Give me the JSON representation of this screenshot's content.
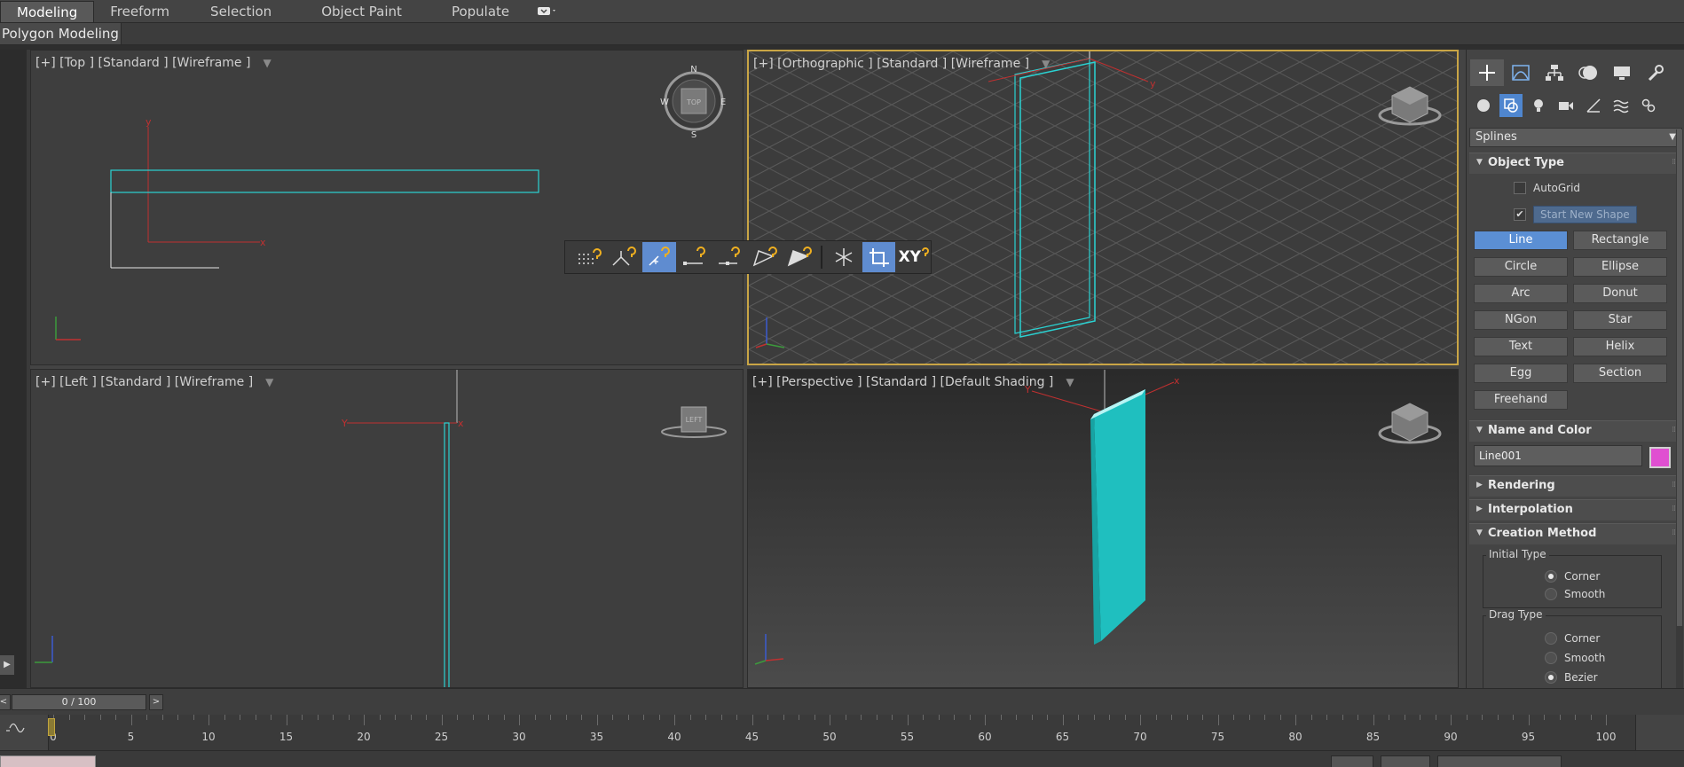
{
  "ribbon": {
    "tabs": [
      "Modeling",
      "Freeform",
      "Selection",
      "Object Paint",
      "Populate"
    ],
    "active_tab": "Modeling",
    "sub_label": "Polygon Modeling"
  },
  "viewports": {
    "top": {
      "label": "[+] [Top ] [Standard ] [Wireframe ]",
      "compass": {
        "n": "N",
        "s": "S",
        "e": "E",
        "w": "W",
        "face": "TOP"
      }
    },
    "ortho": {
      "label": "[+] [Orthographic ] [Standard ] [Wireframe ]"
    },
    "left": {
      "label": "[+] [Left ] [Standard ] [Wireframe ]",
      "cube_face": "LEFT"
    },
    "persp": {
      "label": "[+] [Perspective ] [Standard ] [Default Shading ]"
    }
  },
  "snap_toolbar": {
    "xy_label": "XY"
  },
  "command_panel": {
    "category": "Splines",
    "object_type": {
      "title": "Object Type",
      "autogrid": "AutoGrid",
      "autogrid_checked": false,
      "start_new_shape": "Start New Shape",
      "start_new_shape_checked": true,
      "buttons": [
        "Line",
        "Rectangle",
        "Circle",
        "Ellipse",
        "Arc",
        "Donut",
        "NGon",
        "Star",
        "Text",
        "Helix",
        "Egg",
        "Section",
        "Freehand"
      ],
      "active": "Line"
    },
    "name_and_color": {
      "title": "Name and Color",
      "name": "Line001",
      "color": "#e04fd1"
    },
    "rollouts": [
      "Rendering",
      "Interpolation"
    ],
    "creation_method": {
      "title": "Creation Method",
      "initial_type": {
        "title": "Initial Type",
        "options": [
          "Corner",
          "Smooth"
        ],
        "selected": "Corner"
      },
      "drag_type": {
        "title": "Drag Type",
        "options": [
          "Corner",
          "Smooth",
          "Bezier"
        ],
        "selected": "Bezier"
      }
    }
  },
  "time_slider": {
    "label": "0 / 100",
    "prev": "<",
    "next": ">",
    "ticks": [
      "0",
      "5",
      "10",
      "15",
      "20",
      "25",
      "30",
      "35",
      "40",
      "45",
      "50",
      "55",
      "60",
      "65",
      "70",
      "75",
      "80",
      "85",
      "90",
      "95",
      "100"
    ]
  },
  "colors": {
    "accent": "#5b8fd4",
    "spline": "#2ad3d3",
    "active_border": "#c9a545"
  }
}
